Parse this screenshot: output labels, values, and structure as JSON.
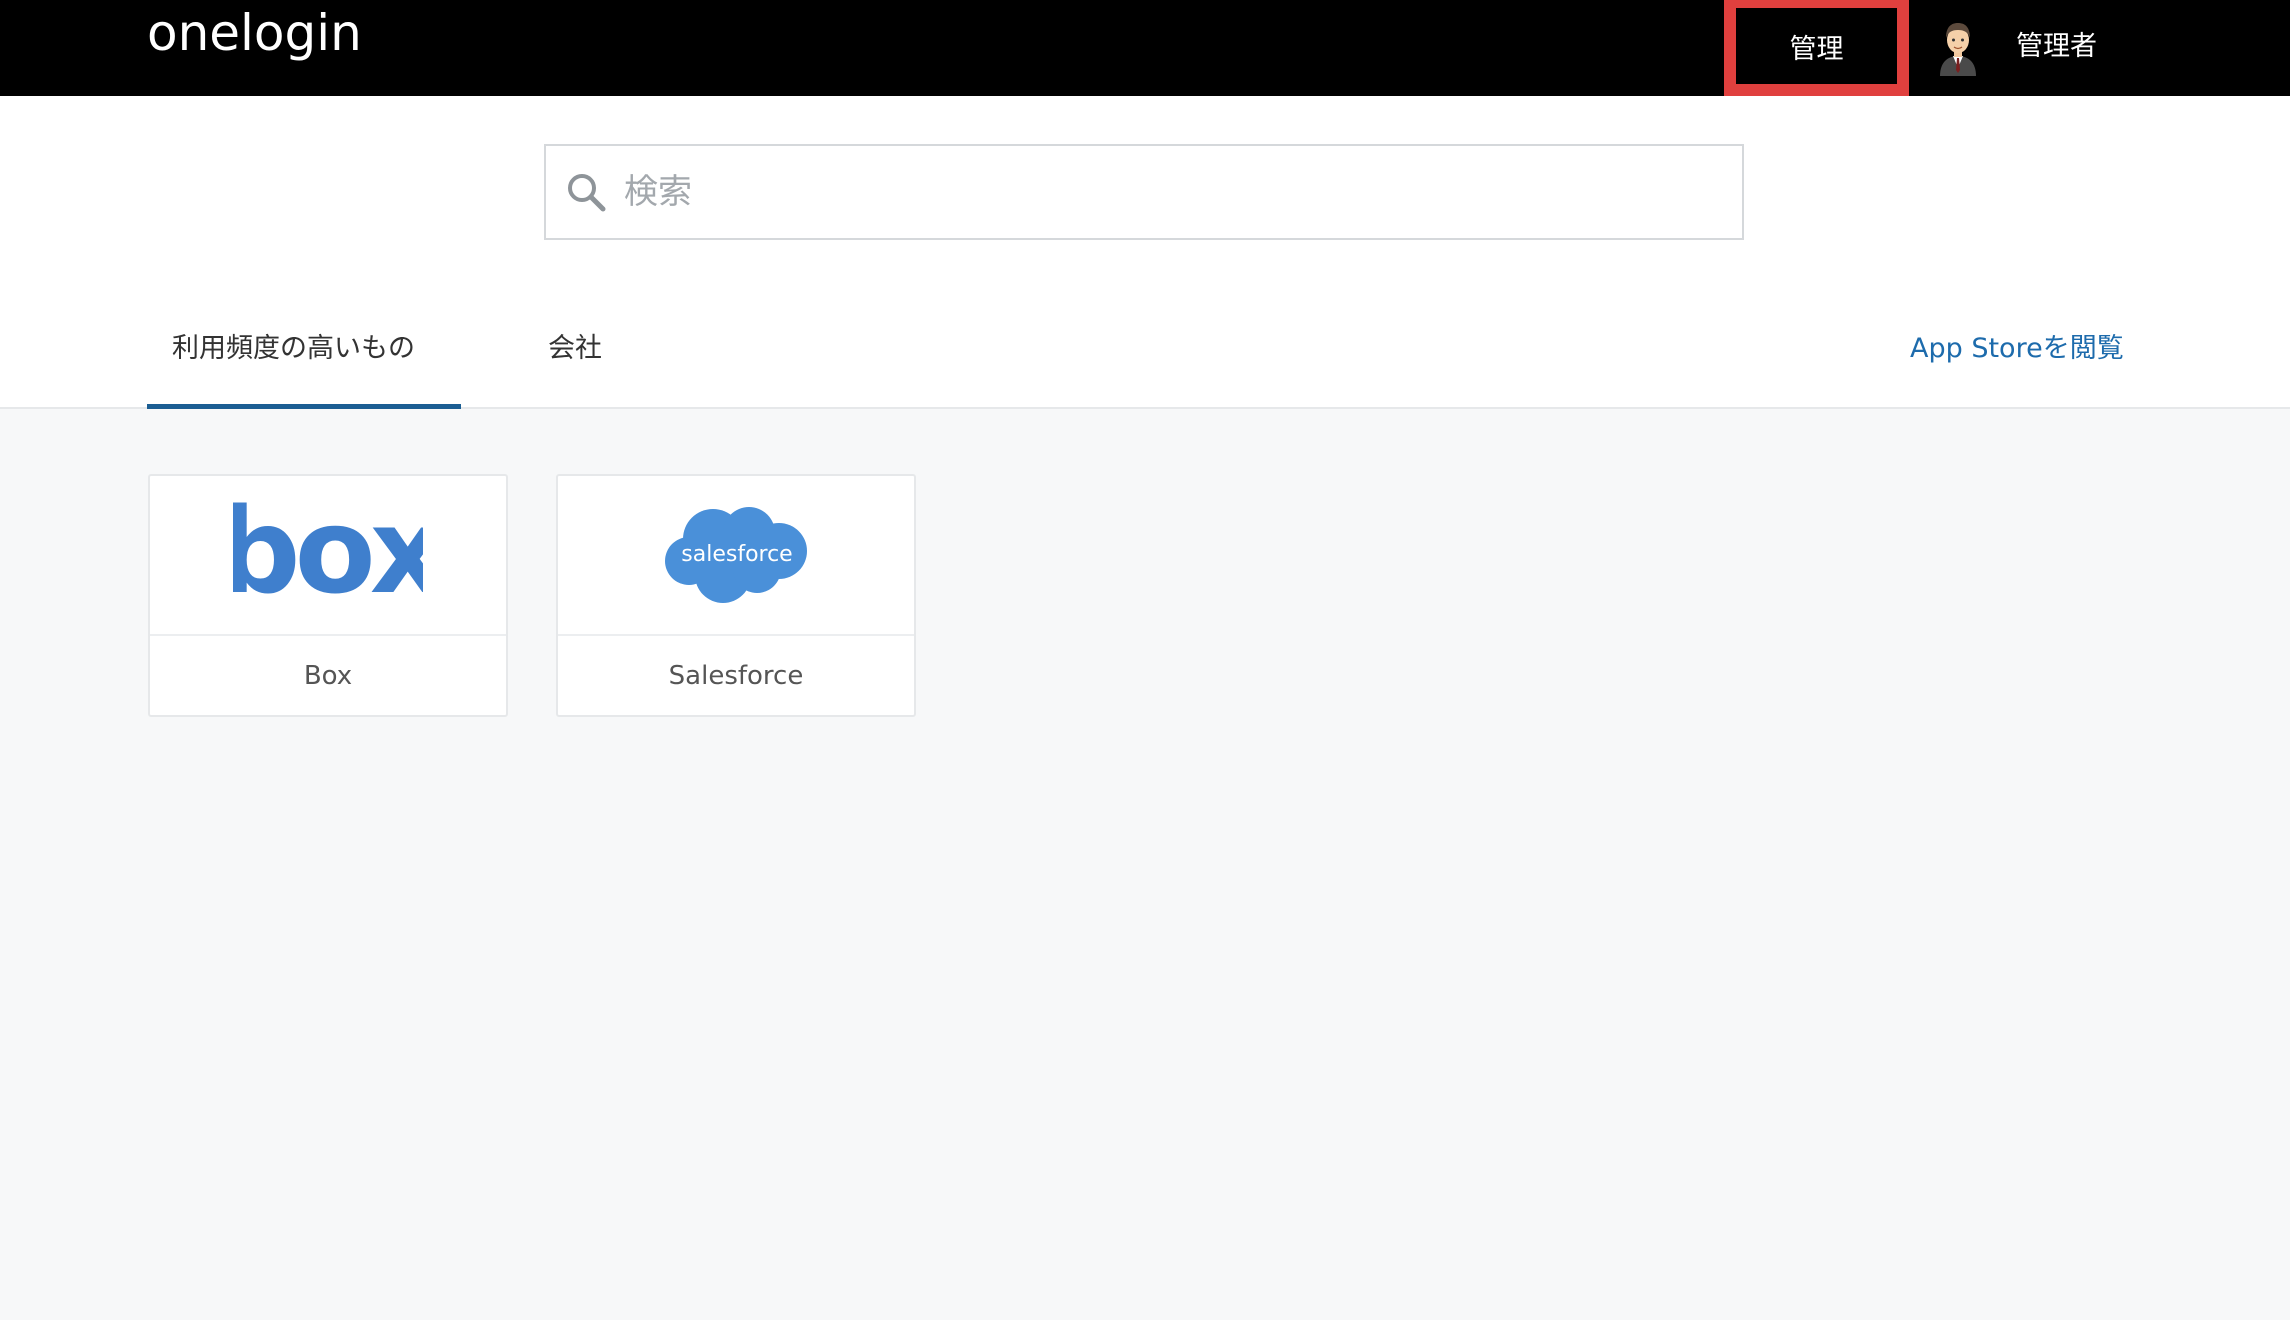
{
  "header": {
    "logo_text": "onelogin",
    "admin_button": "管理",
    "user_name": "管理者",
    "avatar_icon": "user-avatar-icon"
  },
  "search": {
    "placeholder": "検索",
    "value": ""
  },
  "tabs": [
    {
      "label": "利用頻度の高いもの",
      "active": true
    },
    {
      "label": "会社",
      "active": false
    }
  ],
  "appstore_link": "App Storeを閲覧",
  "apps": [
    {
      "name": "Box",
      "logo_text": "box",
      "icon": "box-logo"
    },
    {
      "name": "Salesforce",
      "logo_text": "salesforce",
      "icon": "salesforce-cloud-logo"
    }
  ],
  "colors": {
    "topbar": "#000000",
    "highlight": "#e0403e",
    "link": "#1d6bac",
    "tab_active": "#1b5e93",
    "box_blue": "#3f7fcd",
    "salesforce_blue": "#4a90d9"
  }
}
